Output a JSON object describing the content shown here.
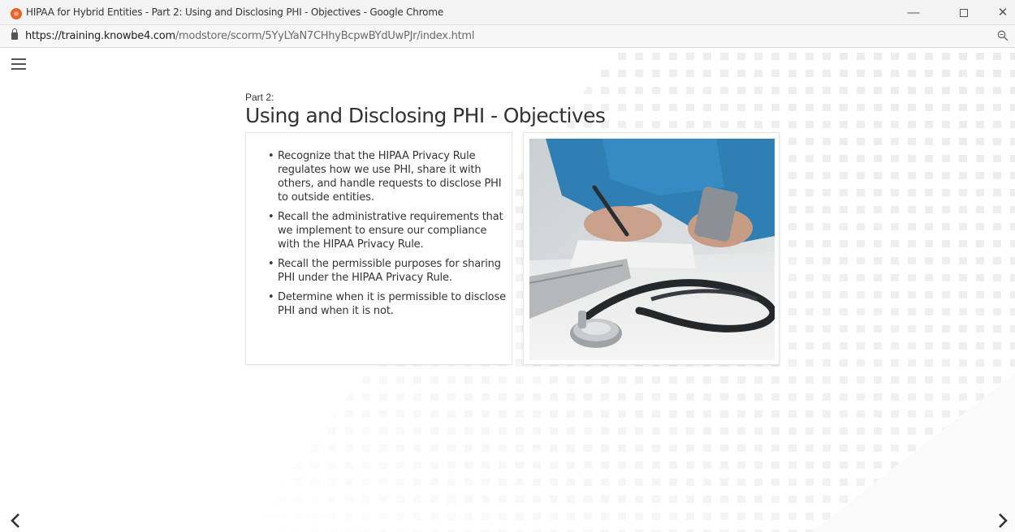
{
  "browser": {
    "window_title": "HIPAA for Hybrid Entities - Part 2: Using and Disclosing PHI - Objectives - Google Chrome",
    "url_base": "https://training.knowbe4.com",
    "url_path": "/modstore/scorm/5YyLYaN7CHhyBcpwBYdUwPJr/index.html",
    "minimize_glyph": "—",
    "close_glyph": "✕"
  },
  "slide": {
    "part_label": "Part 2:",
    "title": "Using and Disclosing PHI - Objectives",
    "objectives": [
      "Recognize that the HIPAA Privacy Rule regulates how we use PHI, share it with others, and handle requests to disclose PHI to outside entities.",
      "Recall the administrative requirements that we implement to ensure our compliance with the HIPAA Privacy Rule.",
      "Recall the permissible purposes for sharing PHI under the HIPAA Privacy Rule.",
      "Determine when it is permissible to disclose PHI and when it is not."
    ]
  },
  "icons": {
    "menu": "hamburger-icon",
    "prev": "chevron-left-icon",
    "next": "chevron-right-icon",
    "lock": "lock-icon",
    "zoom": "magnifier-icon",
    "favicon": "knowbe4-favicon-icon"
  },
  "colors": {
    "favicon": "#e8622c",
    "scrub_blue": "#2f7fb5",
    "text": "#333333"
  }
}
